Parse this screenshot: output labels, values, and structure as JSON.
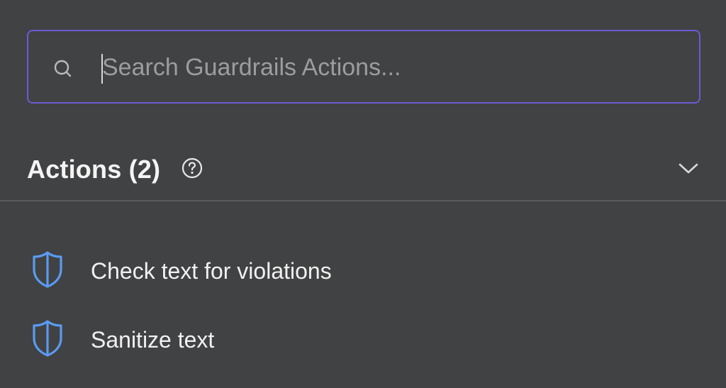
{
  "search": {
    "placeholder": "Search Guardrails Actions..."
  },
  "section": {
    "title": "Actions (2)",
    "help_icon": "question-circle-icon",
    "toggle_icon": "chevron-down-icon"
  },
  "actions": [
    {
      "label": "Check text for violations",
      "icon": "shield-icon"
    },
    {
      "label": "Sanitize text",
      "icon": "shield-icon"
    }
  ],
  "colors": {
    "background": "#414243",
    "focus_border": "#6c5ad6",
    "icon_blue": "#5b9bf2",
    "divider": "#5a5b5d"
  }
}
